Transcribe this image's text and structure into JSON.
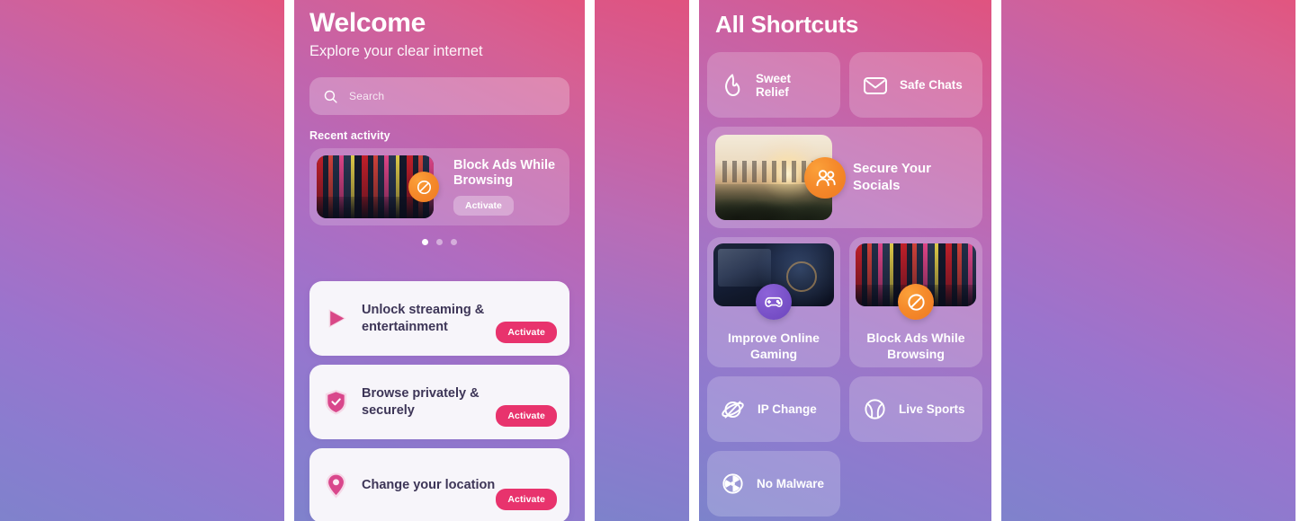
{
  "theme": {
    "gradient_start": "#e2557f",
    "gradient_end": "#7f82cc",
    "accent_pink": "#e8336d",
    "badge_orange": "#f58a2b",
    "badge_purple": "#7a52c9",
    "card_bg": "#f7f5fa",
    "card_text": "#3d3557"
  },
  "left_screen": {
    "title": "Welcome",
    "subtitle": "Explore your clear internet",
    "search": {
      "placeholder": "Search",
      "value": "",
      "icon": "search-icon"
    },
    "recent_section_label": "Recent activity",
    "recent_card": {
      "title": "Block Ads While Browsing",
      "button_label": "Activate",
      "badge_icon": "block-circle-icon",
      "thumbnail": "times-square-photo"
    },
    "carousel": {
      "total_dots": 3,
      "active_index": 0
    },
    "list": [
      {
        "title": "Unlock streaming & entertainment",
        "button_label": "Activate",
        "icon": "play-icon"
      },
      {
        "title": "Browse privately & securely",
        "button_label": "Activate",
        "icon": "shield-check-icon"
      },
      {
        "title": "Change your location",
        "button_label": "Activate",
        "icon": "location-pin-icon"
      }
    ]
  },
  "right_screen": {
    "title": "All Shortcuts",
    "small_tiles_top": [
      {
        "label": "Sweet Relief",
        "icon": "flame-icon"
      },
      {
        "label": "Safe Chats",
        "icon": "envelope-icon"
      }
    ],
    "wide_tile": {
      "label": "Secure Your Socials",
      "badge_icon": "people-icon",
      "thumbnail": "city-sunset-photo"
    },
    "big_tiles": [
      {
        "label": "Improve Online Gaming",
        "badge_icon": "gamepad-icon",
        "thumbnail": "gaming-setup-photo"
      },
      {
        "label": "Block Ads While Browsing",
        "badge_icon": "block-circle-icon",
        "thumbnail": "times-square-photo"
      }
    ],
    "small_tiles_bottom": [
      {
        "label": "IP Change",
        "icon": "globe-slash-icon"
      },
      {
        "label": "Live Sports",
        "icon": "tennis-ball-icon"
      },
      {
        "label": "No Malware",
        "icon": "radiation-icon"
      }
    ]
  }
}
